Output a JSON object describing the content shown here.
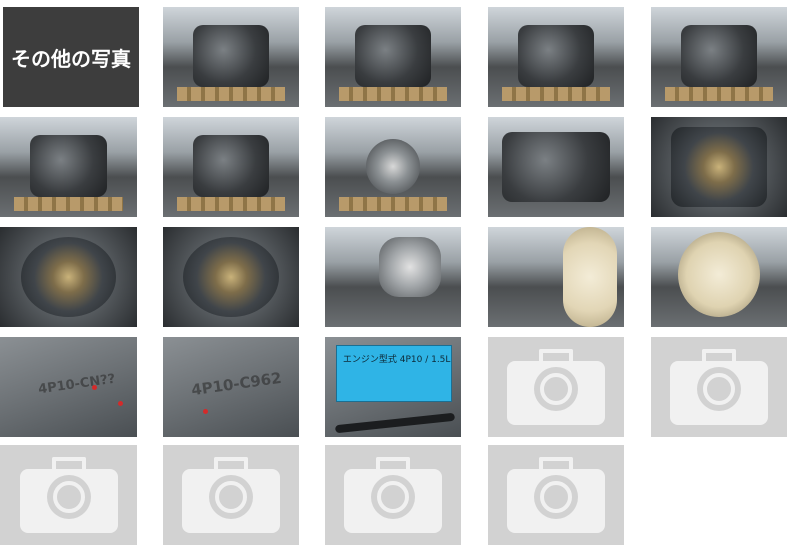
{
  "gallery": {
    "title_label": "その他の写真",
    "sticker_text": "エンジン型式 4P10 / 1.5L",
    "stamp_text_1": "4P10-CN??",
    "stamp_text_2": "4P10-C962"
  }
}
